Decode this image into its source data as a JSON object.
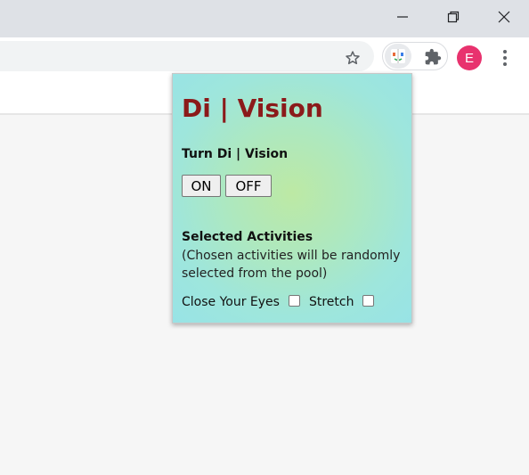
{
  "browser": {
    "window_controls": {
      "minimize_icon": "minimize-icon",
      "restore_icon": "restore-icon",
      "close_icon": "close-icon"
    },
    "toolbar": {
      "bookmark_icon": "star-icon",
      "extensions_icon": "puzzle-icon",
      "profile_initial": "E",
      "menu_icon": "kebab-menu-icon",
      "profile_color": "#e8326e"
    }
  },
  "popup": {
    "title": "Di | Vision",
    "title_color": "#8b1a1a",
    "toggle_label": "Turn Di | Vision",
    "on_label": "ON",
    "off_label": "OFF",
    "activities_title": "Selected Activities",
    "activities_note": "(Chosen activities will be randomly selected from the pool)",
    "activities": [
      {
        "label": "Close Your Eyes",
        "checked": false
      },
      {
        "label": "Stretch",
        "checked": false
      }
    ]
  }
}
